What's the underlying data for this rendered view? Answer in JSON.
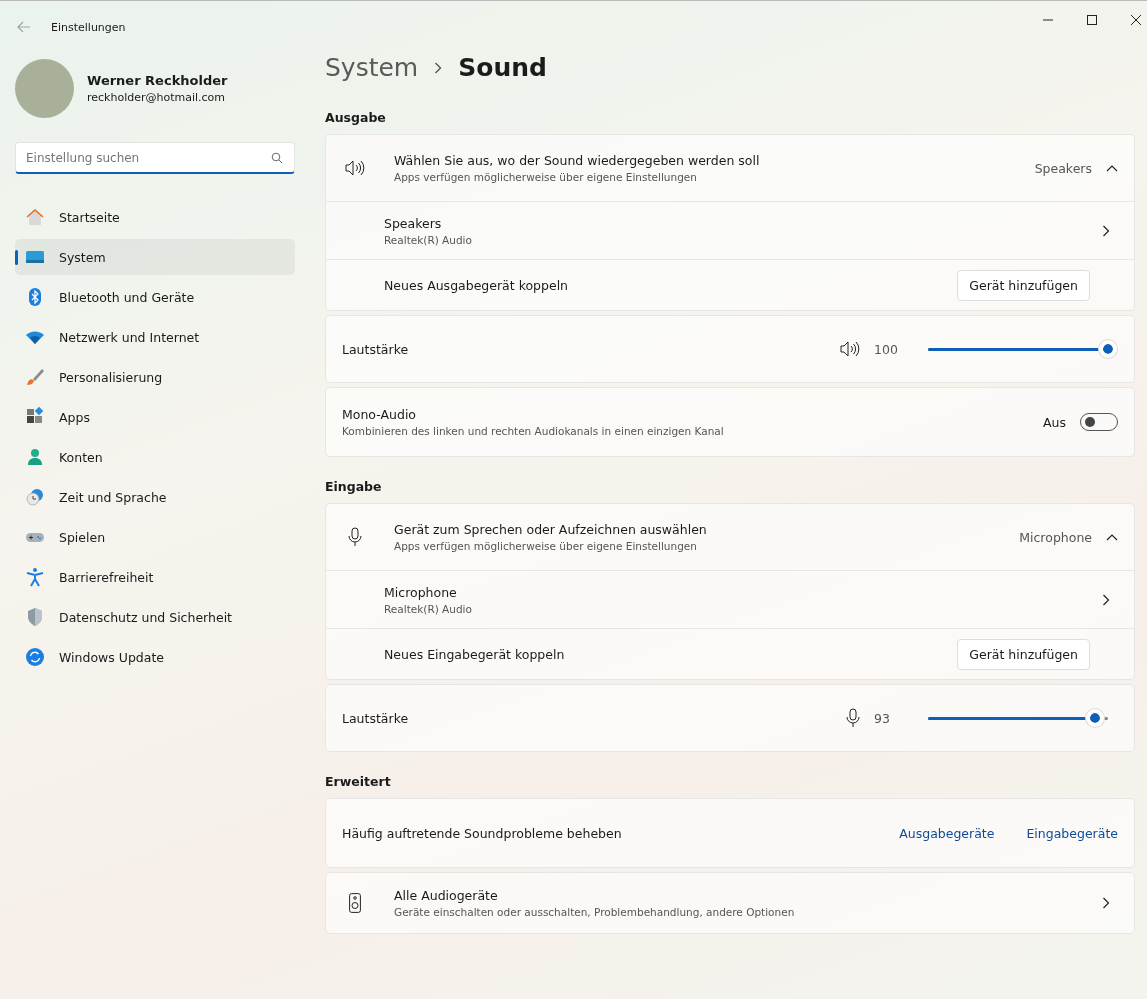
{
  "window": {
    "title": "Einstellungen"
  },
  "user": {
    "name": "Werner Reckholder",
    "email": "reckholder@hotmail.com"
  },
  "search": {
    "placeholder": "Einstellung suchen"
  },
  "sidebar": {
    "items": [
      {
        "label": "Startseite",
        "selected": false
      },
      {
        "label": "System",
        "selected": true
      },
      {
        "label": "Bluetooth und Geräte",
        "selected": false
      },
      {
        "label": "Netzwerk und Internet",
        "selected": false
      },
      {
        "label": "Personalisierung",
        "selected": false
      },
      {
        "label": "Apps",
        "selected": false
      },
      {
        "label": "Konten",
        "selected": false
      },
      {
        "label": "Zeit und Sprache",
        "selected": false
      },
      {
        "label": "Spielen",
        "selected": false
      },
      {
        "label": "Barrierefreiheit",
        "selected": false
      },
      {
        "label": "Datenschutz und Sicherheit",
        "selected": false
      },
      {
        "label": "Windows Update",
        "selected": false
      }
    ]
  },
  "breadcrumb": {
    "parent": "System",
    "current": "Sound"
  },
  "sections": [
    {
      "heading": "Ausgabe",
      "cards": [
        {
          "kind": "expander",
          "title": "Wählen Sie aus, wo der Sound wiedergegeben werden soll",
          "subtitle": "Apps verfügen möglicherweise über eigene Einstellungen",
          "value": "Speakers",
          "expanded": true,
          "rows": [
            {
              "kind": "device",
              "title": "Speakers",
              "subtitle": "Realtek(R) Audio"
            },
            {
              "kind": "pair",
              "title": "Neues Ausgabegerät koppeln",
              "button": "Gerät hinzufügen"
            }
          ]
        },
        {
          "kind": "volume",
          "title": "Lautstärke",
          "reading": "100",
          "level": 1.0
        },
        {
          "kind": "toggle",
          "title": "Mono-Audio",
          "subtitle": "Kombinieren des linken und rechten Audiokanals in einen einzigen Kanal",
          "state_label": "Aus",
          "on": false
        }
      ]
    },
    {
      "heading": "Eingabe",
      "cards": [
        {
          "kind": "expander",
          "title": "Gerät zum Sprechen oder Aufzeichnen auswählen",
          "subtitle": "Apps verfügen möglicherweise über eigene Einstellungen",
          "value": "Microphone",
          "expanded": true,
          "rows": [
            {
              "kind": "device",
              "title": "Microphone",
              "subtitle": "Realtek(R) Audio"
            },
            {
              "kind": "pair",
              "title": "Neues Eingabegerät koppeln",
              "button": "Gerät hinzufügen"
            }
          ]
        },
        {
          "kind": "volume",
          "title": "Lautstärke",
          "reading": "93",
          "level": 0.93
        }
      ]
    },
    {
      "heading": "Erweitert",
      "cards": [
        {
          "kind": "links",
          "title": "Häufig auftretende Soundprobleme beheben",
          "links": [
            "Ausgabegeräte",
            "Eingabegeräte"
          ]
        },
        {
          "kind": "nav",
          "title": "Alle Audiogeräte",
          "subtitle": "Geräte einschalten oder ausschalten, Problembehandlung, andere Optionen"
        }
      ]
    }
  ]
}
